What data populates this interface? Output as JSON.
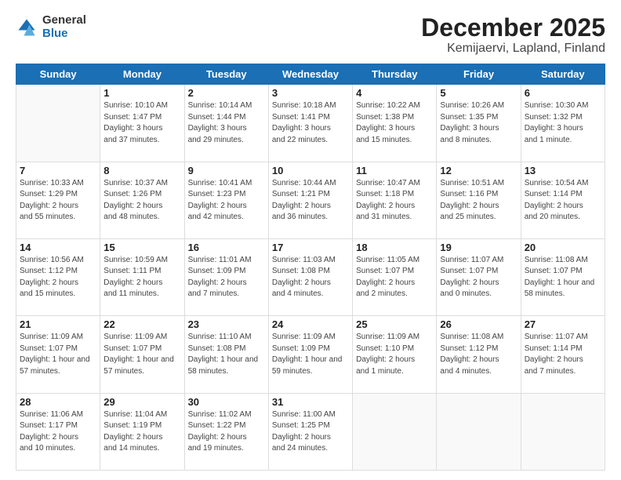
{
  "logo": {
    "general": "General",
    "blue": "Blue"
  },
  "header": {
    "title": "December 2025",
    "subtitle": "Kemijaervi, Lapland, Finland"
  },
  "weekdays": [
    "Sunday",
    "Monday",
    "Tuesday",
    "Wednesday",
    "Thursday",
    "Friday",
    "Saturday"
  ],
  "weeks": [
    [
      {
        "day": "",
        "info": ""
      },
      {
        "day": "1",
        "info": "Sunrise: 10:10 AM\nSunset: 1:47 PM\nDaylight: 3 hours\nand 37 minutes."
      },
      {
        "day": "2",
        "info": "Sunrise: 10:14 AM\nSunset: 1:44 PM\nDaylight: 3 hours\nand 29 minutes."
      },
      {
        "day": "3",
        "info": "Sunrise: 10:18 AM\nSunset: 1:41 PM\nDaylight: 3 hours\nand 22 minutes."
      },
      {
        "day": "4",
        "info": "Sunrise: 10:22 AM\nSunset: 1:38 PM\nDaylight: 3 hours\nand 15 minutes."
      },
      {
        "day": "5",
        "info": "Sunrise: 10:26 AM\nSunset: 1:35 PM\nDaylight: 3 hours\nand 8 minutes."
      },
      {
        "day": "6",
        "info": "Sunrise: 10:30 AM\nSunset: 1:32 PM\nDaylight: 3 hours\nand 1 minute."
      }
    ],
    [
      {
        "day": "7",
        "info": "Sunrise: 10:33 AM\nSunset: 1:29 PM\nDaylight: 2 hours\nand 55 minutes."
      },
      {
        "day": "8",
        "info": "Sunrise: 10:37 AM\nSunset: 1:26 PM\nDaylight: 2 hours\nand 48 minutes."
      },
      {
        "day": "9",
        "info": "Sunrise: 10:41 AM\nSunset: 1:23 PM\nDaylight: 2 hours\nand 42 minutes."
      },
      {
        "day": "10",
        "info": "Sunrise: 10:44 AM\nSunset: 1:21 PM\nDaylight: 2 hours\nand 36 minutes."
      },
      {
        "day": "11",
        "info": "Sunrise: 10:47 AM\nSunset: 1:18 PM\nDaylight: 2 hours\nand 31 minutes."
      },
      {
        "day": "12",
        "info": "Sunrise: 10:51 AM\nSunset: 1:16 PM\nDaylight: 2 hours\nand 25 minutes."
      },
      {
        "day": "13",
        "info": "Sunrise: 10:54 AM\nSunset: 1:14 PM\nDaylight: 2 hours\nand 20 minutes."
      }
    ],
    [
      {
        "day": "14",
        "info": "Sunrise: 10:56 AM\nSunset: 1:12 PM\nDaylight: 2 hours\nand 15 minutes."
      },
      {
        "day": "15",
        "info": "Sunrise: 10:59 AM\nSunset: 1:11 PM\nDaylight: 2 hours\nand 11 minutes."
      },
      {
        "day": "16",
        "info": "Sunrise: 11:01 AM\nSunset: 1:09 PM\nDaylight: 2 hours\nand 7 minutes."
      },
      {
        "day": "17",
        "info": "Sunrise: 11:03 AM\nSunset: 1:08 PM\nDaylight: 2 hours\nand 4 minutes."
      },
      {
        "day": "18",
        "info": "Sunrise: 11:05 AM\nSunset: 1:07 PM\nDaylight: 2 hours\nand 2 minutes."
      },
      {
        "day": "19",
        "info": "Sunrise: 11:07 AM\nSunset: 1:07 PM\nDaylight: 2 hours\nand 0 minutes."
      },
      {
        "day": "20",
        "info": "Sunrise: 11:08 AM\nSunset: 1:07 PM\nDaylight: 1 hour and\n58 minutes."
      }
    ],
    [
      {
        "day": "21",
        "info": "Sunrise: 11:09 AM\nSunset: 1:07 PM\nDaylight: 1 hour and\n57 minutes."
      },
      {
        "day": "22",
        "info": "Sunrise: 11:09 AM\nSunset: 1:07 PM\nDaylight: 1 hour and\n57 minutes."
      },
      {
        "day": "23",
        "info": "Sunrise: 11:10 AM\nSunset: 1:08 PM\nDaylight: 1 hour and\n58 minutes."
      },
      {
        "day": "24",
        "info": "Sunrise: 11:09 AM\nSunset: 1:09 PM\nDaylight: 1 hour and\n59 minutes."
      },
      {
        "day": "25",
        "info": "Sunrise: 11:09 AM\nSunset: 1:10 PM\nDaylight: 2 hours\nand 1 minute."
      },
      {
        "day": "26",
        "info": "Sunrise: 11:08 AM\nSunset: 1:12 PM\nDaylight: 2 hours\nand 4 minutes."
      },
      {
        "day": "27",
        "info": "Sunrise: 11:07 AM\nSunset: 1:14 PM\nDaylight: 2 hours\nand 7 minutes."
      }
    ],
    [
      {
        "day": "28",
        "info": "Sunrise: 11:06 AM\nSunset: 1:17 PM\nDaylight: 2 hours\nand 10 minutes."
      },
      {
        "day": "29",
        "info": "Sunrise: 11:04 AM\nSunset: 1:19 PM\nDaylight: 2 hours\nand 14 minutes."
      },
      {
        "day": "30",
        "info": "Sunrise: 11:02 AM\nSunset: 1:22 PM\nDaylight: 2 hours\nand 19 minutes."
      },
      {
        "day": "31",
        "info": "Sunrise: 11:00 AM\nSunset: 1:25 PM\nDaylight: 2 hours\nand 24 minutes."
      },
      {
        "day": "",
        "info": ""
      },
      {
        "day": "",
        "info": ""
      },
      {
        "day": "",
        "info": ""
      }
    ]
  ]
}
